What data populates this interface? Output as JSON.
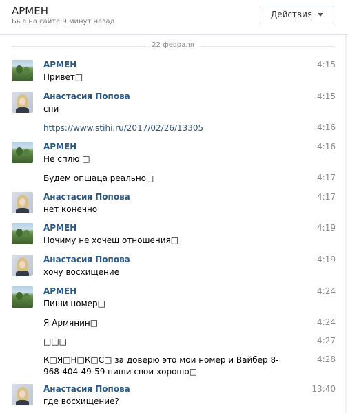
{
  "header": {
    "title": "АРМЕН",
    "subtitle": "Был на сайте 9 минут назад",
    "actions_label": "Действия"
  },
  "date_separator": "22 февраля",
  "messages": [
    {
      "author": "АРМЕН",
      "avatar": "armen",
      "text": "Привет□",
      "time": "4:15"
    },
    {
      "author": "Анастасия Попова",
      "avatar": "anastasia",
      "text": "спи",
      "time": "4:15"
    },
    {
      "author": "",
      "avatar": "",
      "text": "https://www.stihi.ru/2017/02/26/13305",
      "time": "4:16",
      "link": true
    },
    {
      "author": "АРМЕН",
      "avatar": "armen",
      "text": "Не сплю □",
      "time": "4:16"
    },
    {
      "author": "",
      "avatar": "",
      "text": "Будем опшаца реально□",
      "time": "4:17"
    },
    {
      "author": "Анастасия Попова",
      "avatar": "anastasia",
      "text": "нет конечно",
      "time": "4:17"
    },
    {
      "author": "АРМЕН",
      "avatar": "armen",
      "text": "Почиму не хочеш отношения□",
      "time": "4:19"
    },
    {
      "author": "Анастасия Попова",
      "avatar": "anastasia",
      "text": "хочу восхищение",
      "time": "4:19"
    },
    {
      "author": "АРМЕН",
      "avatar": "armen",
      "text": "Пиши номер□",
      "time": "4:24"
    },
    {
      "author": "",
      "avatar": "",
      "text": "Я Армянин□",
      "time": "4:24"
    },
    {
      "author": "",
      "avatar": "",
      "text": "□□□",
      "time": "4:27"
    },
    {
      "author": "",
      "avatar": "",
      "text": "К□Я□Н□К□С□ за доверю это мои номер и Вайбер 8-968-404-49-59 пиши свои хорошо□",
      "time": "4:28"
    },
    {
      "author": "Анастасия Попова",
      "avatar": "anastasia",
      "text": "где восхищение?",
      "time": "13:40"
    }
  ]
}
